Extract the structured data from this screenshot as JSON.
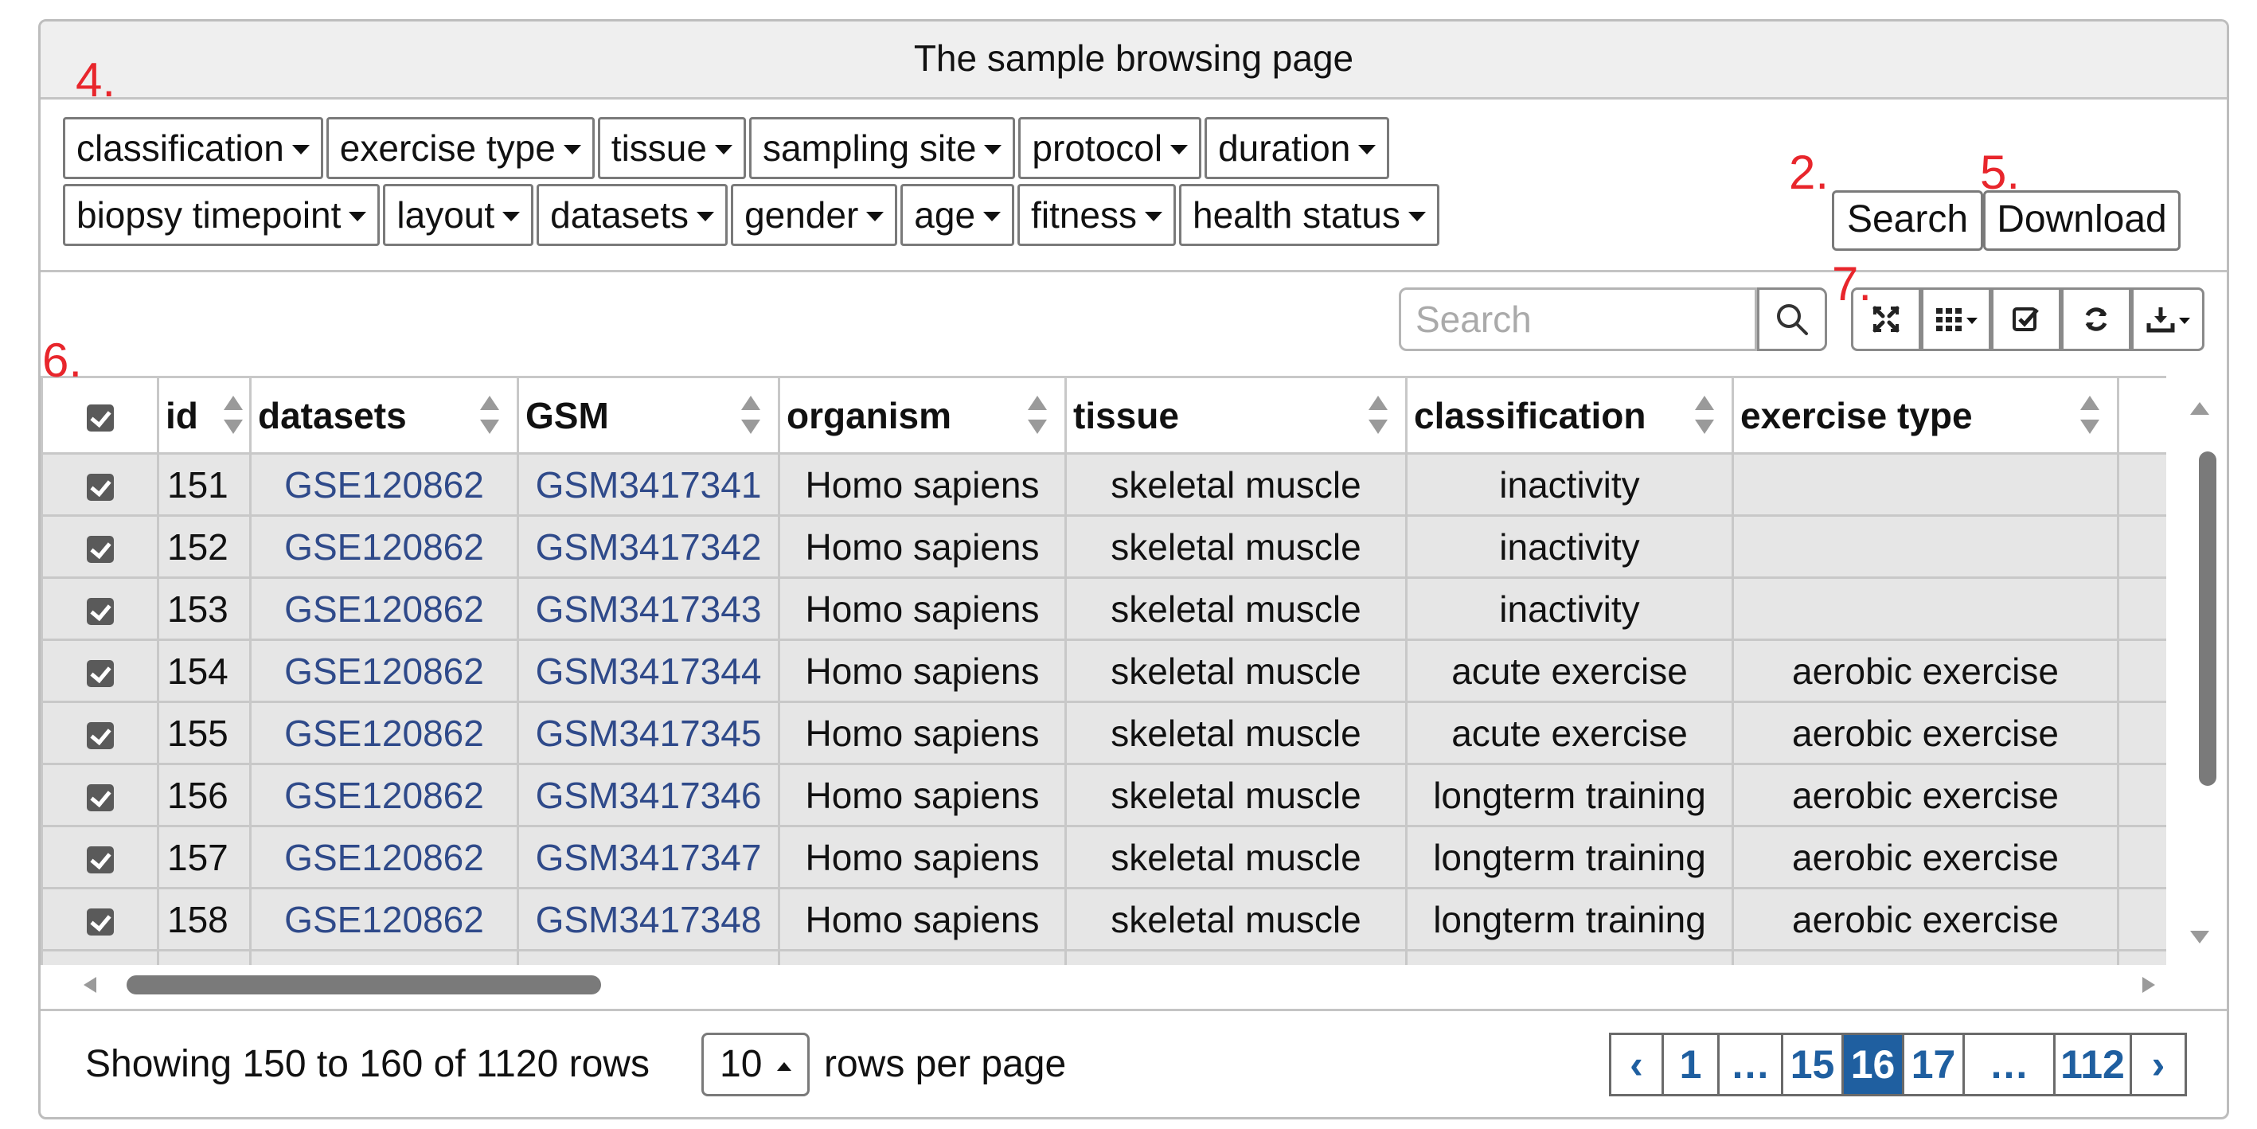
{
  "panel": {
    "title": "The sample browsing page"
  },
  "markers": {
    "m2": "2.",
    "m4": "4.",
    "m5": "5.",
    "m6": "6.",
    "m7": "7."
  },
  "filters": {
    "row1": [
      "classification",
      "exercise type",
      "tissue",
      "sampling site",
      "protocol",
      "duration"
    ],
    "row2": [
      "biopsy timepoint",
      "layout",
      "datasets",
      "gender",
      "age",
      "fitness",
      "health status"
    ]
  },
  "actions": {
    "search_label": "Search",
    "download_label": "Download"
  },
  "toolbar": {
    "search_placeholder": "Search",
    "icons": [
      "search-icon",
      "fullscreen-icon",
      "columns-icon",
      "toggle-icon",
      "refresh-icon",
      "export-icon"
    ]
  },
  "table": {
    "columns": [
      "id",
      "datasets",
      "GSM",
      "organism",
      "tissue",
      "classification",
      "exercise type"
    ],
    "rows": [
      {
        "id": "151",
        "datasets": "GSE120862",
        "gsm": "GSM3417341",
        "organism": "Homo sapiens",
        "tissue": "skeletal muscle",
        "classification": "inactivity",
        "exercise_type": ""
      },
      {
        "id": "152",
        "datasets": "GSE120862",
        "gsm": "GSM3417342",
        "organism": "Homo sapiens",
        "tissue": "skeletal muscle",
        "classification": "inactivity",
        "exercise_type": ""
      },
      {
        "id": "153",
        "datasets": "GSE120862",
        "gsm": "GSM3417343",
        "organism": "Homo sapiens",
        "tissue": "skeletal muscle",
        "classification": "inactivity",
        "exercise_type": ""
      },
      {
        "id": "154",
        "datasets": "GSE120862",
        "gsm": "GSM3417344",
        "organism": "Homo sapiens",
        "tissue": "skeletal muscle",
        "classification": "acute exercise",
        "exercise_type": "aerobic exercise"
      },
      {
        "id": "155",
        "datasets": "GSE120862",
        "gsm": "GSM3417345",
        "organism": "Homo sapiens",
        "tissue": "skeletal muscle",
        "classification": "acute exercise",
        "exercise_type": "aerobic exercise"
      },
      {
        "id": "156",
        "datasets": "GSE120862",
        "gsm": "GSM3417346",
        "organism": "Homo sapiens",
        "tissue": "skeletal muscle",
        "classification": "longterm training",
        "exercise_type": "aerobic exercise"
      },
      {
        "id": "157",
        "datasets": "GSE120862",
        "gsm": "GSM3417347",
        "organism": "Homo sapiens",
        "tissue": "skeletal muscle",
        "classification": "longterm training",
        "exercise_type": "aerobic exercise"
      },
      {
        "id": "158",
        "datasets": "GSE120862",
        "gsm": "GSM3417348",
        "organism": "Homo sapiens",
        "tissue": "skeletal muscle",
        "classification": "longterm training",
        "exercise_type": "aerobic exercise"
      }
    ]
  },
  "footer": {
    "showing": "Showing 150 to 160 of 1120 rows",
    "rows_per_page_value": "10",
    "rows_per_page_label": "rows per page"
  },
  "pagination": {
    "prev": "‹",
    "pages": [
      "1",
      "…",
      "15",
      "16",
      "17",
      "…",
      "112"
    ],
    "active": "16",
    "next": "›"
  },
  "colors": {
    "link": "#2f4a8a",
    "accent": "#1f5fa0",
    "marker": "#e8262c",
    "row_bg": "#e6e6e6"
  }
}
